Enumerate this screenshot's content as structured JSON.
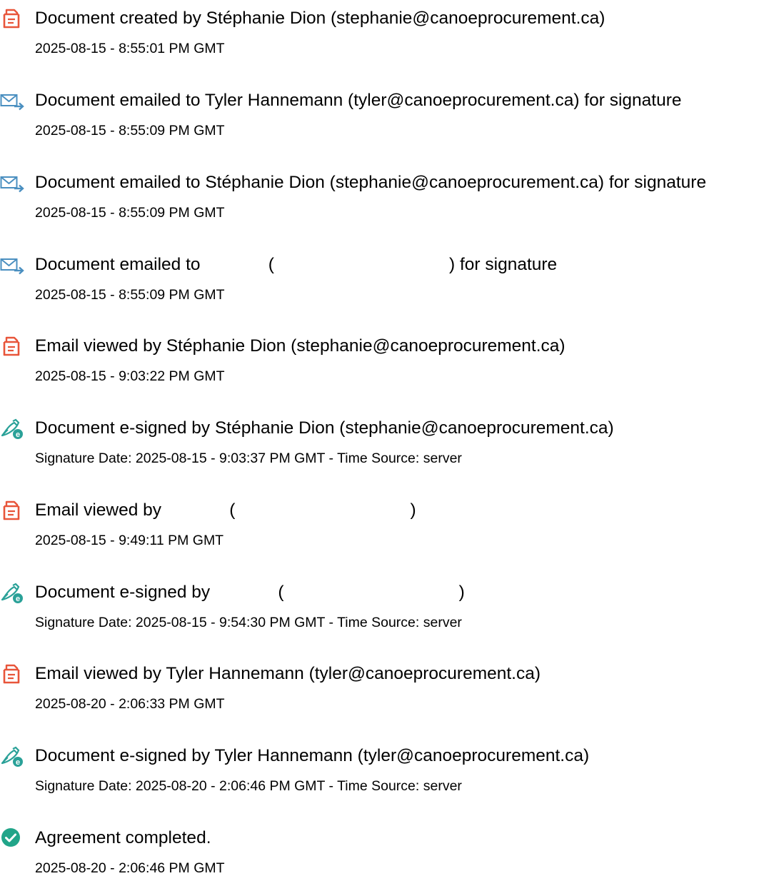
{
  "colors": {
    "document_icon": "#e8553a",
    "email_icon": "#4a8fc0",
    "esign_icon": "#2aa198",
    "completed_icon": "#21a589",
    "text": "#000000"
  },
  "events": [
    {
      "icon": "document-icon",
      "title": "Document created by Stéphanie Dion (stephanie@canoeprocurement.ca)",
      "detail": "2025-08-15 - 8:55:01 PM GMT"
    },
    {
      "icon": "email-sent-icon",
      "title": "Document emailed to Tyler Hannemann (tyler@canoeprocurement.ca) for signature",
      "detail": "2025-08-15 - 8:55:09 PM GMT"
    },
    {
      "icon": "email-sent-icon",
      "title": "Document emailed to Stéphanie Dion (stephanie@canoeprocurement.ca) for signature",
      "detail": "2025-08-15 - 8:55:09 PM GMT"
    },
    {
      "icon": "email-sent-icon",
      "title": "Document emailed to              (                                    ) for signature",
      "detail": "2025-08-15 - 8:55:09 PM GMT"
    },
    {
      "icon": "document-icon",
      "title": "Email viewed by Stéphanie Dion (stephanie@canoeprocurement.ca)",
      "detail": "2025-08-15 - 9:03:22 PM GMT"
    },
    {
      "icon": "esign-icon",
      "title": "Document e-signed by Stéphanie Dion (stephanie@canoeprocurement.ca)",
      "detail": "Signature Date: 2025-08-15 - 9:03:37 PM GMT - Time Source: server"
    },
    {
      "icon": "document-icon",
      "title": "Email viewed by              (                                    )",
      "detail": "2025-08-15 - 9:49:11 PM GMT"
    },
    {
      "icon": "esign-icon",
      "title": "Document e-signed by              (                                    )",
      "detail": "Signature Date: 2025-08-15 - 9:54:30 PM GMT - Time Source: server"
    },
    {
      "icon": "document-icon",
      "title": "Email viewed by Tyler Hannemann (tyler@canoeprocurement.ca)",
      "detail": "2025-08-20 - 2:06:33 PM GMT"
    },
    {
      "icon": "esign-icon",
      "title": "Document e-signed by Tyler Hannemann (tyler@canoeprocurement.ca)",
      "detail": "Signature Date: 2025-08-20 - 2:06:46 PM GMT - Time Source: server"
    },
    {
      "icon": "check-circle-icon",
      "title": "Agreement completed.",
      "detail": "2025-08-20 - 2:06:46 PM GMT"
    }
  ]
}
